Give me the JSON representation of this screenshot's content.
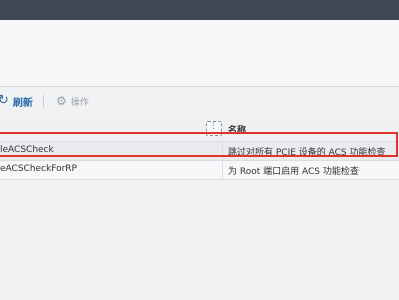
{
  "toolbar": {
    "refresh_icon": "refresh-icon",
    "refresh_label": "刷新",
    "ops_icon": "gear-icon",
    "ops_label": "操作"
  },
  "table": {
    "column_header": "名称",
    "rows": [
      {
        "key": "leACSCheck",
        "description": "跳过对所有 PCIE 设备的 ACS 功能检查"
      },
      {
        "key": "eACSCheckForRP",
        "description": "为 Root 端口启用 ACS 功能检查"
      }
    ]
  },
  "colors": {
    "accent": "#2a6aa8",
    "highlight_box": "#e0332b",
    "topbar": "#3d4756"
  }
}
